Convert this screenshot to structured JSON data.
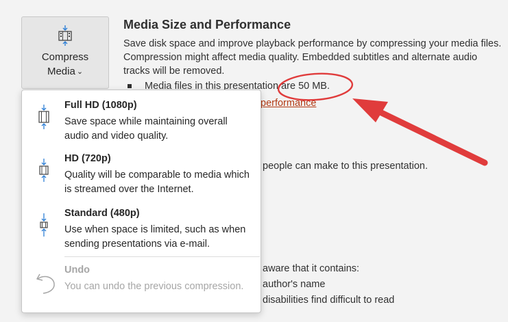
{
  "compress_button": {
    "line1": "Compress",
    "line2": "Media",
    "chevron": "⌄"
  },
  "section": {
    "title": "Media Size and Performance",
    "description": "Save disk space and improve playback performance by compressing your media files. Compression might affect media quality. Embedded subtitles and alternate audio tracks will be removed.",
    "bullet": "Media files in this presentation are 50 MB.",
    "link_fragment": "performance"
  },
  "background_fragments": {
    "people": "people can make to this presentation.",
    "aware": "aware that it contains:",
    "author": "author's name",
    "disabilities": "disabilities find difficult to read"
  },
  "menu": {
    "items": [
      {
        "title": "Full HD (1080p)",
        "desc": "Save space while maintaining overall audio and video quality.",
        "icon": "compress-full-hd-icon",
        "enabled": true
      },
      {
        "title": "HD (720p)",
        "desc": "Quality will be comparable to media which is streamed over the Internet.",
        "icon": "compress-hd-icon",
        "enabled": true
      },
      {
        "title": "Standard (480p)",
        "desc": "Use when space is limited, such as when sending presentations via e-mail.",
        "icon": "compress-standard-icon",
        "enabled": true
      },
      {
        "title": "Undo",
        "desc": "You can undo the previous compression.",
        "icon": "undo-icon",
        "enabled": false
      }
    ]
  },
  "colors": {
    "annotation_red": "#e03c3c",
    "link": "#b33a14",
    "icon_blue": "#2e7fd6"
  }
}
